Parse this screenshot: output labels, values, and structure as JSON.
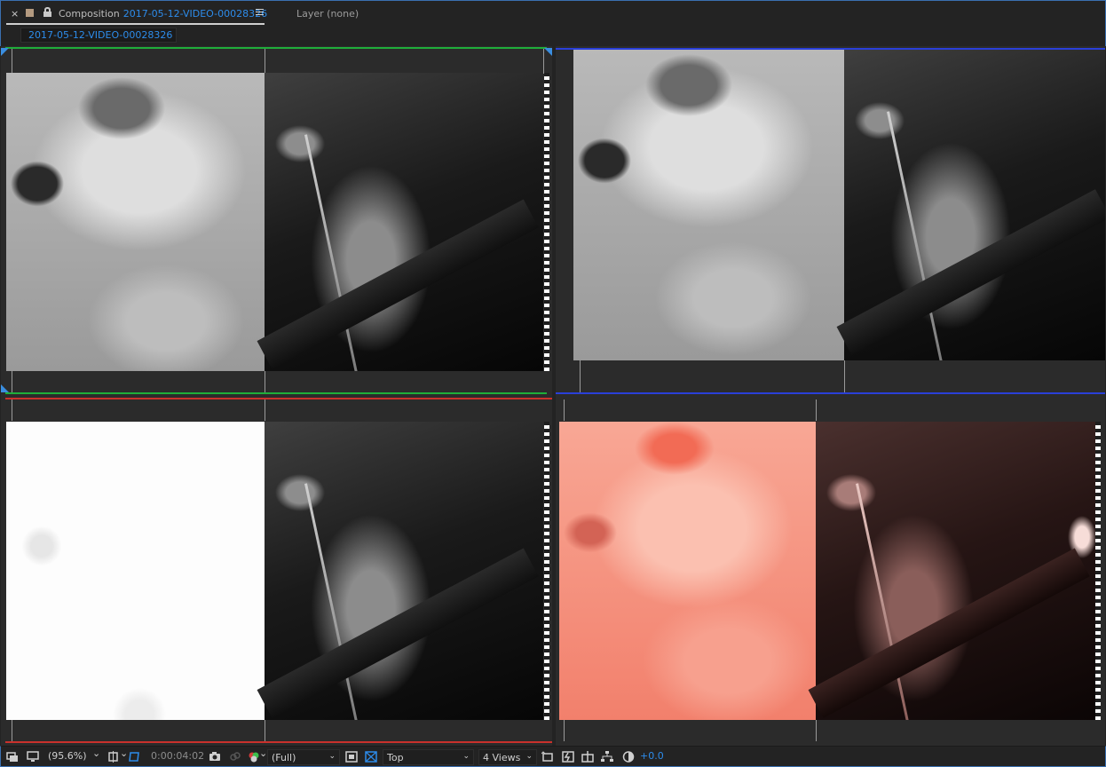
{
  "header": {
    "close_label": "×",
    "comp_prefix": "Composition",
    "comp_name": "2017-05-12-VIDEO-00028326",
    "layer_tab": "Layer (none)"
  },
  "breadcrumb": "2017-05-12-VIDEO-00028326",
  "views": [
    {
      "name": "top-left",
      "grade": "grayscale",
      "accent": "#1fae3a"
    },
    {
      "name": "top-right",
      "grade": "grayscale",
      "accent": "#2a3fd8"
    },
    {
      "name": "bottom-left",
      "grade": "white-matte",
      "accent": "#c9312c"
    },
    {
      "name": "bottom-right",
      "grade": "red-tint",
      "accent": "#2b2b2b"
    }
  ],
  "toolbar": {
    "zoom": "(95.6%)",
    "timecode": "0:00:04:02",
    "resolution": "(Full)",
    "view": "Top",
    "layout": "4 Views",
    "exposure": "+0.0",
    "chevron": "⌄"
  },
  "colors": {
    "accent_blue": "#2d8ceb",
    "green": "#1fae3a",
    "blue": "#2a3fd8",
    "red": "#c9312c"
  }
}
